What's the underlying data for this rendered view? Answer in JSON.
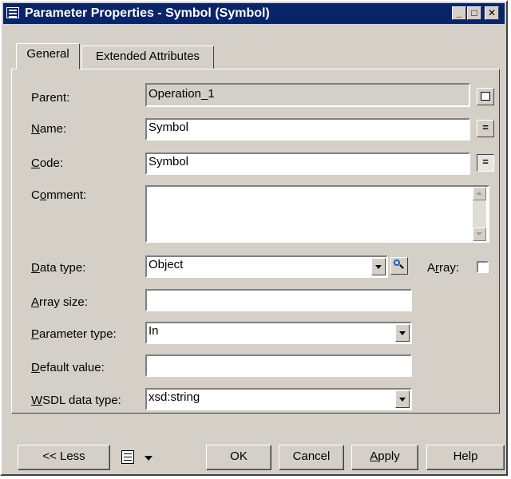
{
  "window": {
    "title": "Parameter Properties - Symbol (Symbol)"
  },
  "caption_buttons": {
    "minimize": "_",
    "maximize": "□",
    "close": "✕"
  },
  "tabs": [
    {
      "label": "General",
      "active": true
    },
    {
      "label": "Extended Attributes",
      "active": false
    }
  ],
  "form": {
    "parent": {
      "label": "Parent:",
      "value": "Operation_1"
    },
    "name": {
      "label_key": "N",
      "label_rest": "ame:",
      "value": "Symbol"
    },
    "code": {
      "label_key": "C",
      "label_rest": "ode:",
      "value": "Symbol"
    },
    "comment": {
      "label_pre": "C",
      "label_key": "o",
      "label_rest": "mment:",
      "value": ""
    },
    "data_type": {
      "label_key": "D",
      "label_rest": "ata type:",
      "value": "Object"
    },
    "array": {
      "label_pre": "A",
      "label_key": "r",
      "label_rest": "ray:",
      "checked": false
    },
    "array_size": {
      "label_key": "A",
      "label_rest": "rray size:",
      "value": ""
    },
    "parameter_type": {
      "label_key": "P",
      "label_rest": "arameter type:",
      "value": "In"
    },
    "default_value": {
      "label_key": "D",
      "label_rest": "efault value:",
      "value": ""
    },
    "wsdl_data_type": {
      "label_key": "W",
      "label_rest": "SDL data type:",
      "value": "xsd:string"
    }
  },
  "buttons": {
    "less": "<< Less",
    "ok": "OK",
    "cancel": "Cancel",
    "apply_key": "A",
    "apply_rest": "pply",
    "help": "Help"
  },
  "colors": {
    "face": "#d4d0c8",
    "titlebar": "#0a246a"
  }
}
